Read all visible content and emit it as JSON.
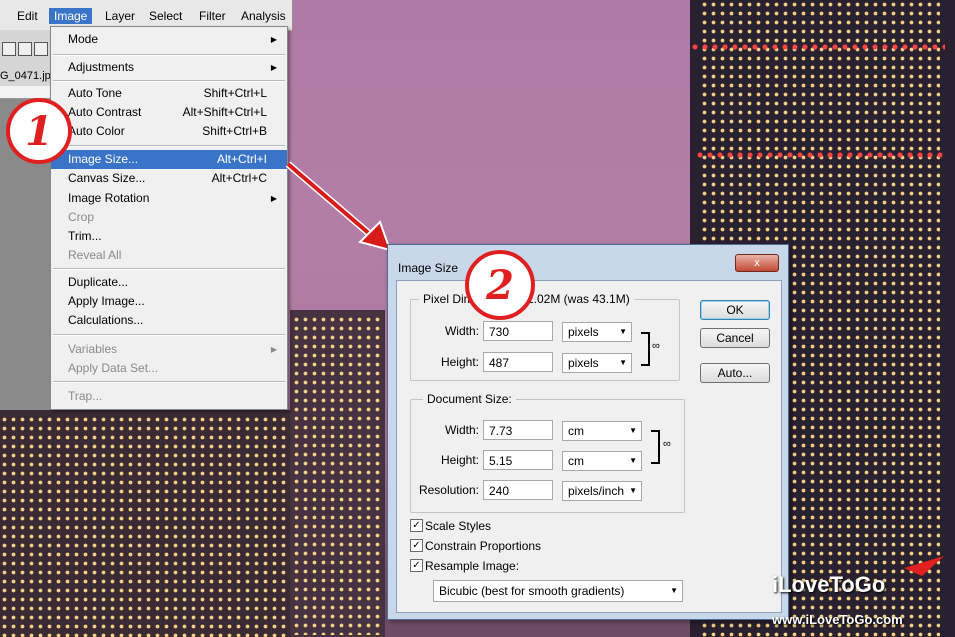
{
  "menubar": {
    "items": [
      {
        "label": "Edit"
      },
      {
        "label": "Image"
      },
      {
        "label": "Layer"
      },
      {
        "label": "Select"
      },
      {
        "label": "Filter"
      },
      {
        "label": "Analysis"
      }
    ]
  },
  "document": {
    "tab_label": "G_0471.jp"
  },
  "image_menu": {
    "items": [
      {
        "label": "Mode",
        "shortcut": "",
        "submenu": true,
        "disabled": false
      },
      {
        "label": "Adjustments",
        "shortcut": "",
        "submenu": true,
        "disabled": false
      },
      {
        "label": "Auto Tone",
        "shortcut": "Shift+Ctrl+L",
        "submenu": false,
        "disabled": false
      },
      {
        "label": "Auto Contrast",
        "shortcut": "Alt+Shift+Ctrl+L",
        "submenu": false,
        "disabled": false
      },
      {
        "label": "Auto Color",
        "shortcut": "Shift+Ctrl+B",
        "submenu": false,
        "disabled": false
      },
      {
        "label": "Image Size...",
        "shortcut": "Alt+Ctrl+I",
        "submenu": false,
        "disabled": false,
        "highlighted": true
      },
      {
        "label": "Canvas Size...",
        "shortcut": "Alt+Ctrl+C",
        "submenu": false,
        "disabled": false
      },
      {
        "label": "Image Rotation",
        "shortcut": "",
        "submenu": true,
        "disabled": false
      },
      {
        "label": "Crop",
        "shortcut": "",
        "submenu": false,
        "disabled": true
      },
      {
        "label": "Trim...",
        "shortcut": "",
        "submenu": false,
        "disabled": false
      },
      {
        "label": "Reveal All",
        "shortcut": "",
        "submenu": false,
        "disabled": true
      },
      {
        "label": "Duplicate...",
        "shortcut": "",
        "submenu": false,
        "disabled": false
      },
      {
        "label": "Apply Image...",
        "shortcut": "",
        "submenu": false,
        "disabled": false
      },
      {
        "label": "Calculations...",
        "shortcut": "",
        "submenu": false,
        "disabled": false
      },
      {
        "label": "Variables",
        "shortcut": "",
        "submenu": true,
        "disabled": true
      },
      {
        "label": "Apply Data Set...",
        "shortcut": "",
        "submenu": false,
        "disabled": true
      },
      {
        "label": "Trap...",
        "shortcut": "",
        "submenu": false,
        "disabled": true
      }
    ]
  },
  "steps": {
    "one": "1",
    "two": "2"
  },
  "dialog": {
    "title": "Image Size",
    "close": "x",
    "pixel_dimensions": {
      "title_prefix": "Pixel Dim",
      "title_suffix": "1.02M (was 43.1M)",
      "width_label": "Width:",
      "width_value": "730",
      "width_unit": "pixels",
      "height_label": "Height:",
      "height_value": "487",
      "height_unit": "pixels"
    },
    "document_size": {
      "title": "Document Size:",
      "width_label": "Width:",
      "width_value": "7.73",
      "width_unit": "cm",
      "height_label": "Height:",
      "height_value": "5.15",
      "height_unit": "cm",
      "resolution_label": "Resolution:",
      "resolution_value": "240",
      "resolution_unit": "pixels/inch"
    },
    "buttons": {
      "ok": "OK",
      "cancel": "Cancel",
      "auto": "Auto..."
    },
    "checkboxes": [
      {
        "label": "Scale Styles",
        "checked": true
      },
      {
        "label": "Constrain Proportions",
        "checked": true
      },
      {
        "label": "Resample Image:",
        "checked": true
      }
    ],
    "resample_method": "Bicubic (best for smooth gradients)"
  },
  "brand": {
    "logo_text": "iLoveToGo",
    "url": "www.iLoveToGo.com"
  },
  "colors": {
    "accent": "#3a74c8",
    "badge_red": "#e02020",
    "dialog_frame": "#c9d7ea"
  }
}
